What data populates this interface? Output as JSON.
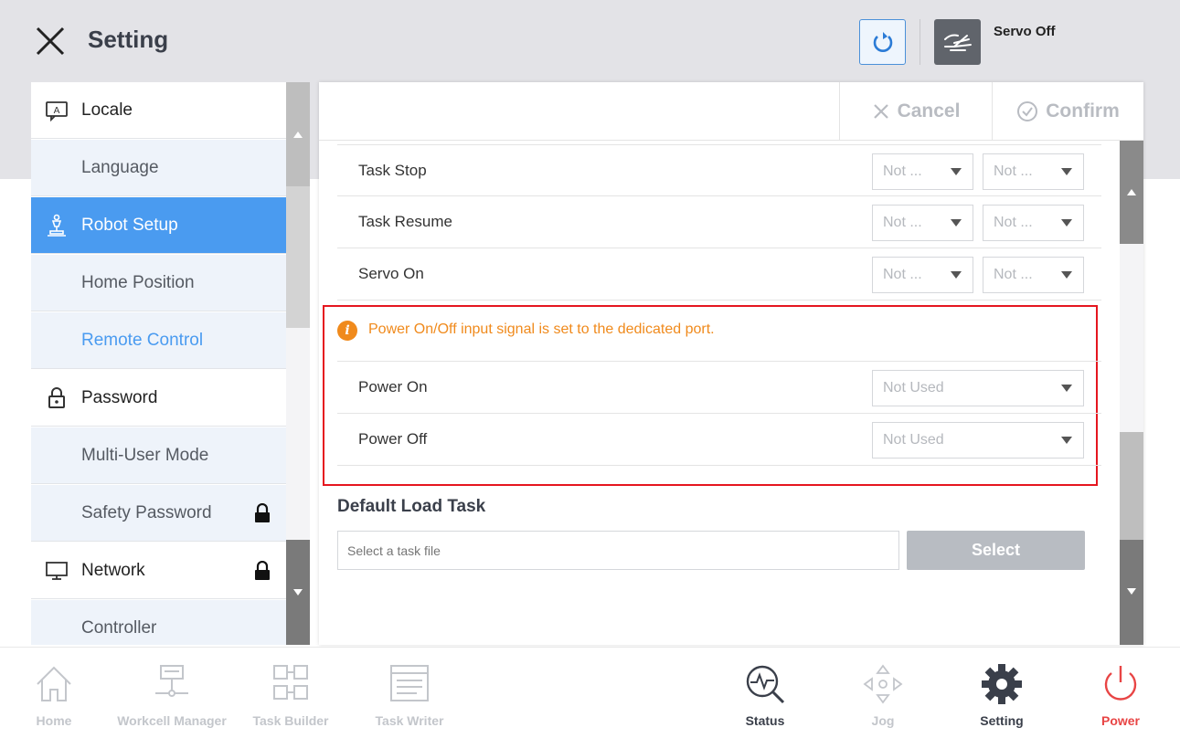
{
  "header": {
    "title": "Setting",
    "servo_status": "Servo Off"
  },
  "sidebar": {
    "items": [
      {
        "label": "Locale"
      },
      {
        "label": "Language"
      },
      {
        "label": "Robot Setup"
      },
      {
        "label": "Home Position"
      },
      {
        "label": "Remote Control"
      },
      {
        "label": "Password"
      },
      {
        "label": "Multi-User Mode"
      },
      {
        "label": "Safety Password"
      },
      {
        "label": "Network"
      },
      {
        "label": "Controller"
      }
    ]
  },
  "actions": {
    "cancel_label": "Cancel",
    "confirm_label": "Confirm"
  },
  "signals": [
    {
      "label": "Task Stop",
      "select1": "Not ...",
      "select2": "Not ..."
    },
    {
      "label": "Task Resume",
      "select1": "Not ...",
      "select2": "Not ..."
    },
    {
      "label": "Servo On",
      "select1": "Not ...",
      "select2": "Not ..."
    }
  ],
  "power": {
    "info": "Power On/Off input signal is set to the dedicated port.",
    "rows": [
      {
        "label": "Power On",
        "value": "Not Used"
      },
      {
        "label": "Power Off",
        "value": "Not Used"
      }
    ]
  },
  "default_load_task": {
    "title": "Default Load Task",
    "placeholder": "Select a task file",
    "button_label": "Select"
  },
  "nav": {
    "items": [
      {
        "label": "Home"
      },
      {
        "label": "Workcell Manager"
      },
      {
        "label": "Task Builder"
      },
      {
        "label": "Task Writer"
      },
      {
        "label": "Status"
      },
      {
        "label": "Jog"
      },
      {
        "label": "Setting"
      },
      {
        "label": "Power"
      }
    ]
  },
  "colors": {
    "accent": "#4a9bf0",
    "warning": "#f08a1c",
    "highlight_border": "#e5161f",
    "power": "#e84545"
  }
}
